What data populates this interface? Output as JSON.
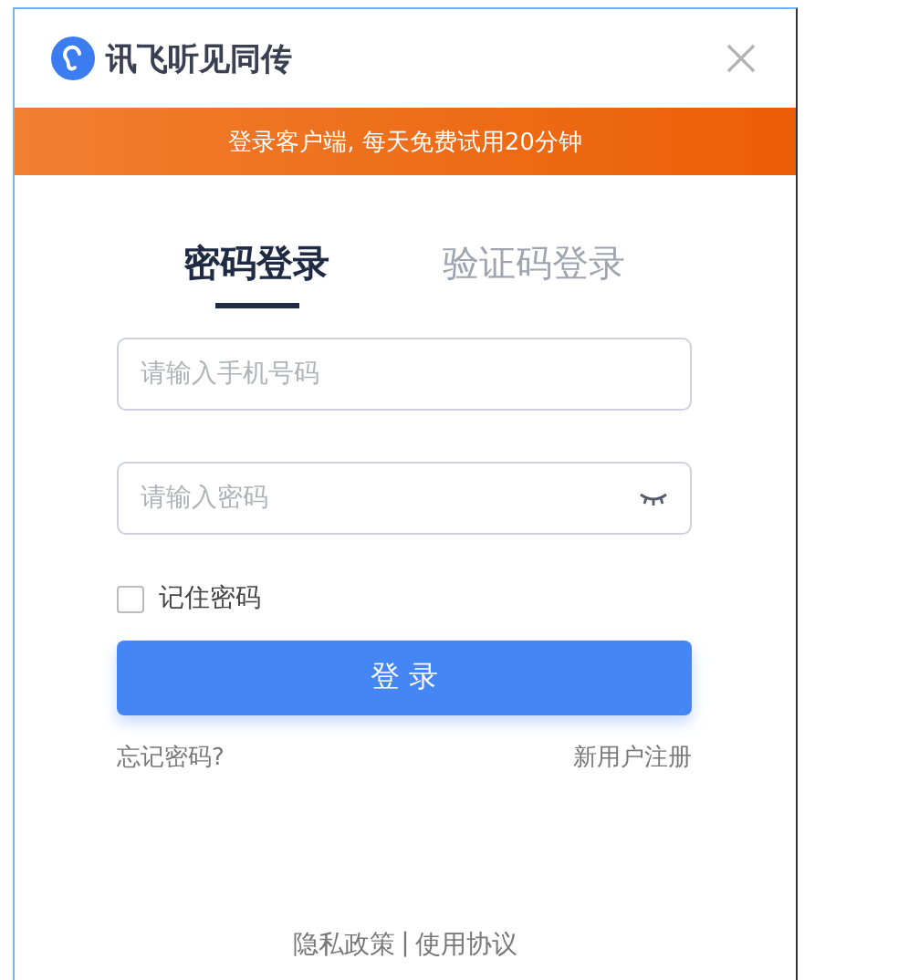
{
  "window": {
    "title": "讯飞听见同传"
  },
  "banner": "登录客户端, 每天免费试用20分钟",
  "tabs": [
    {
      "label": "密码登录",
      "selected": true
    },
    {
      "label": "验证码登录",
      "selected": false
    }
  ],
  "phone_field": {
    "placeholder": "请输入手机号码"
  },
  "password_field": {
    "placeholder": "请输入密码"
  },
  "remember": {
    "label": "记住密码",
    "checked": false
  },
  "login_button": "登 录",
  "links": {
    "forgot": "忘记密码?",
    "register": "新用户注册"
  },
  "footer": {
    "privacy": "隐私政策",
    "separator": "|",
    "terms": "使用协议"
  }
}
